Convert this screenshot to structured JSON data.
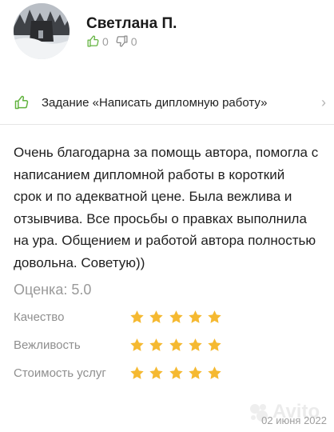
{
  "author": {
    "name": "Светлана П.",
    "likes": "0",
    "dislikes": "0"
  },
  "task": {
    "text": "Задание «Написать дипломную работу»",
    "icon": "thumbs-up-icon",
    "accent": "#62b33f"
  },
  "review": {
    "text": "Очень благодарна за помощь автора, помогла с\nнаписанием дипломной работы  в короткий\nсрок и по адекватной цене. Была вежлива и\nотзывчива. Все просьбы о правках выполнила\nна ура.  Общением и работой автора полностью\nдовольна. Советую))"
  },
  "rating": {
    "title": "Оценка: 5.0",
    "star_color": "#f5b931",
    "criteria": [
      {
        "label": "Качество",
        "stars": 5
      },
      {
        "label": "Вежливость",
        "stars": 5
      },
      {
        "label": "Стоимость услуг",
        "stars": 5
      }
    ]
  },
  "watermark": "Avito",
  "date": "02 июня 2022"
}
